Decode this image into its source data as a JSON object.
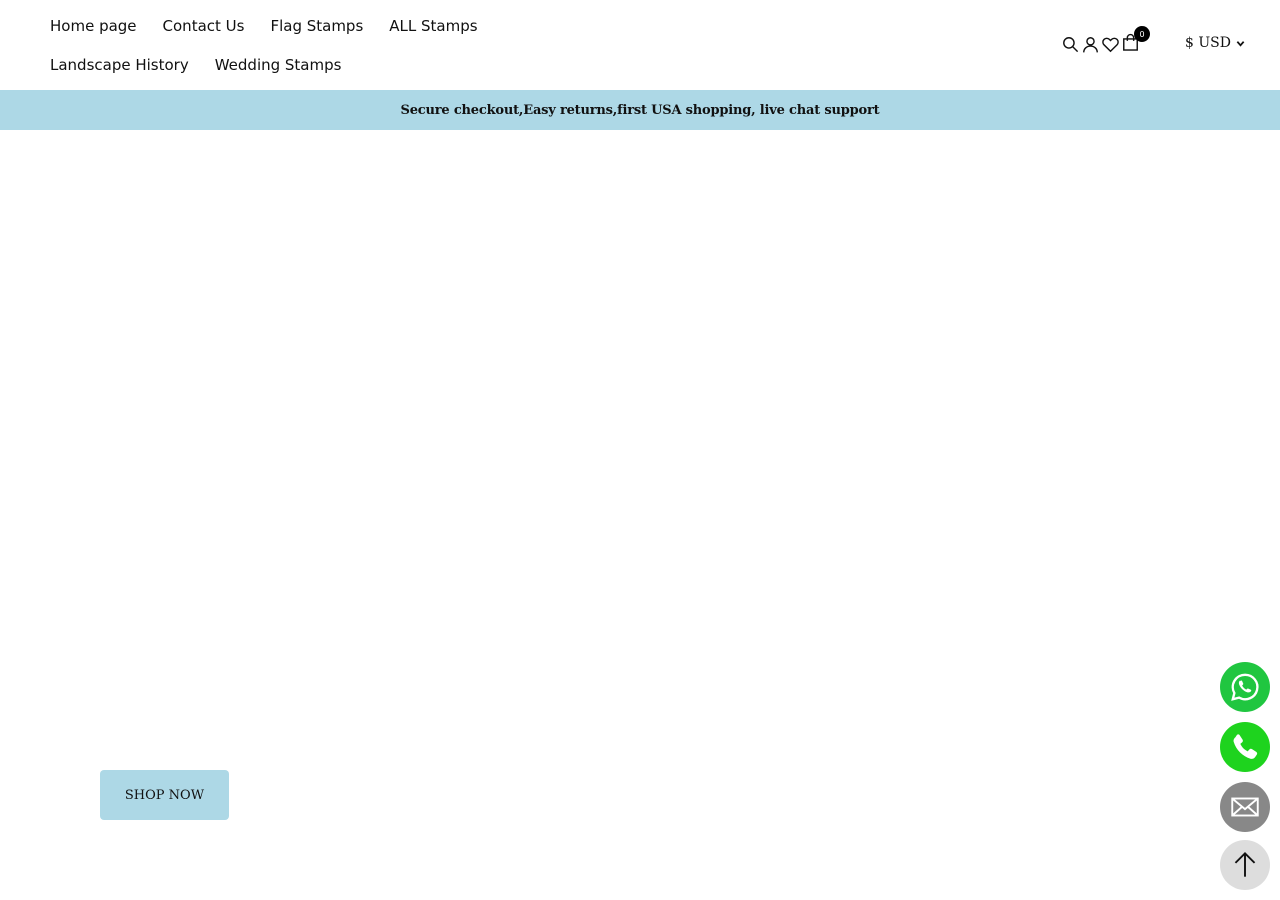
{
  "nav": {
    "row1": [
      "Home page",
      "Contact Us",
      "Flag Stamps",
      "ALL Stamps"
    ],
    "row2": [
      "Landscape History",
      "Wedding Stamps"
    ]
  },
  "header_icons": {
    "search": "search-icon",
    "account": "user-icon",
    "wishlist": "heart-icon",
    "cart": "shopping-bag-icon",
    "cart_count": "0"
  },
  "currency": {
    "label": "$ USD"
  },
  "announcement": {
    "text": "Secure checkout,Easy returns,first USA shopping, live chat support"
  },
  "hero": {
    "button_label": "SHOP NOW"
  },
  "floating": {
    "whatsapp": "whatsapp-icon",
    "phone": "phone-icon",
    "email": "mail-icon",
    "back_to_top": "arrow-up-icon"
  },
  "colors": {
    "accent": "#add8e6",
    "whatsapp": "#20c640",
    "phone": "#1ed31e",
    "mail": "#888888",
    "top": "#dddddd"
  }
}
